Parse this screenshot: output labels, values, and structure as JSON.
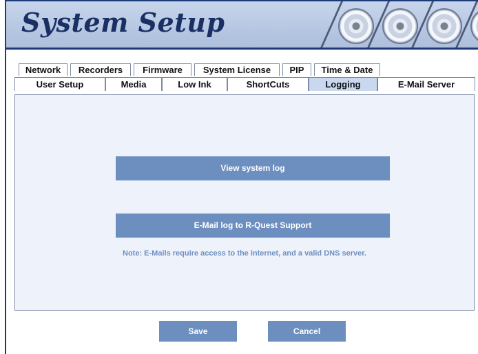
{
  "window": {
    "title": "System Setup"
  },
  "tabs": {
    "row1": [
      "Network",
      "Recorders",
      "Firmware",
      "System License",
      "PIP",
      "Time & Date"
    ],
    "row2": [
      "User Setup",
      "Media",
      "Low Ink",
      "ShortCuts",
      "Logging",
      "E-Mail Server"
    ],
    "active": "Logging"
  },
  "logging": {
    "view_log_label": "View system log",
    "email_log_label": "E-Mail log to R-Quest Support",
    "note": "Note: E-Mails require access to the internet, and a valid DNS server."
  },
  "footer": {
    "save_label": "Save",
    "cancel_label": "Cancel"
  },
  "colors": {
    "accent": "#6d8fc0",
    "header_bg": "#b6c7e2",
    "border": "#1c3a78",
    "active_tab": "#c9d8ef",
    "panel_bg": "#eef2fb"
  },
  "icons": [
    "disc-icon"
  ]
}
